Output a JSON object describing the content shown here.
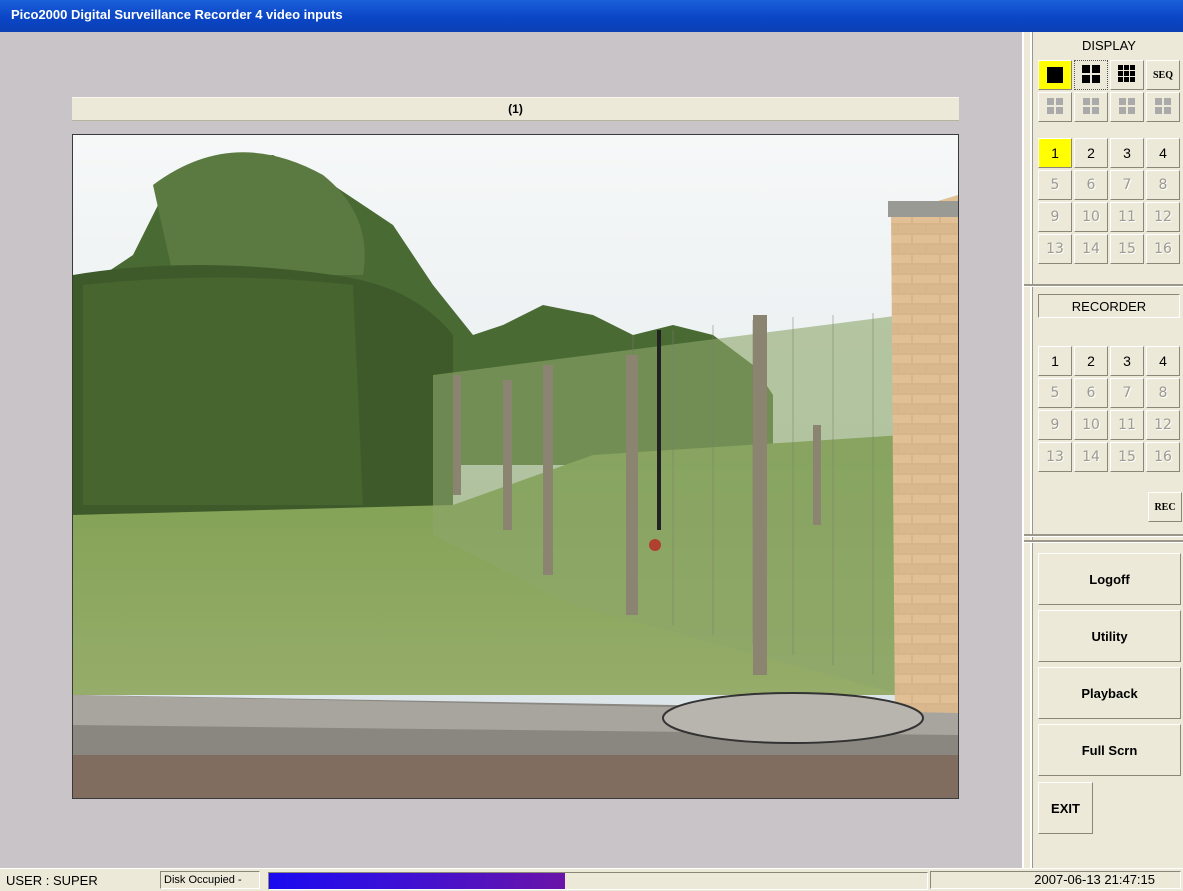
{
  "window": {
    "title": "Pico2000 Digital Surveillance Recorder 4 video inputs"
  },
  "main": {
    "camera_label": "(1)"
  },
  "display": {
    "heading": "DISPLAY",
    "layout_buttons": [
      {
        "name": "single-view",
        "icon": "single-square-icon",
        "selected": true
      },
      {
        "name": "quad-view",
        "icon": "quad-grid-icon",
        "selected": false
      },
      {
        "name": "nine-view",
        "icon": "nine-grid-icon",
        "selected": false
      },
      {
        "name": "sequence",
        "label": "SEQ",
        "selected": false
      }
    ],
    "extra_layout_icons": [
      "grid-layout-icon",
      "grid-layout-icon",
      "grid-layout-icon",
      "grid-layout-icon"
    ],
    "channels": [
      "1",
      "2",
      "3",
      "4",
      "5",
      "6",
      "7",
      "8",
      "9",
      "10",
      "11",
      "12",
      "13",
      "14",
      "15",
      "16"
    ],
    "selected_channel": "1",
    "enabled_channel_count": 4
  },
  "recorder": {
    "heading": "RECORDER",
    "channels": [
      "1",
      "2",
      "3",
      "4",
      "5",
      "6",
      "7",
      "8",
      "9",
      "10",
      "11",
      "12",
      "13",
      "14",
      "15",
      "16"
    ],
    "enabled_channel_count": 4,
    "rec_label": "REC"
  },
  "actions": {
    "logoff": "Logoff",
    "utility": "Utility",
    "playback": "Playback",
    "full_screen": "Full Scrn",
    "exit": "EXIT"
  },
  "status": {
    "user": "USER : SUPER",
    "disk_label": "Disk Occupied -",
    "disk_fraction": 0.45,
    "datetime": "2007-06-13   21:47:15"
  },
  "colors": {
    "title_bar": "#0a46c6",
    "selected": "#ffff00",
    "disk_bar": "#3a10d8"
  }
}
